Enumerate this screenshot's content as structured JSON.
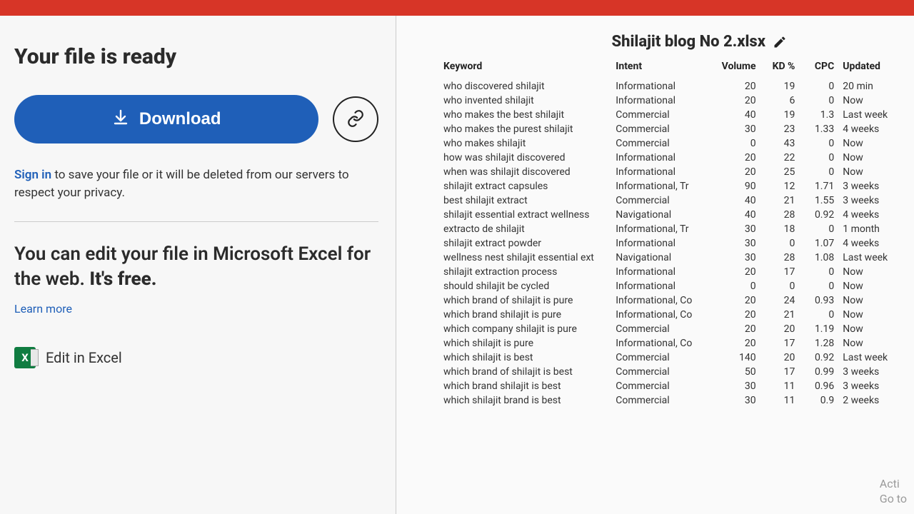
{
  "left": {
    "heading": "Your file is ready",
    "download_label": "Download",
    "signin_link": "Sign in",
    "signin_rest": " to save your file or it will be deleted from our servers to respect your privacy.",
    "edit_promo_a": "You can edit your file in Microsoft Excel for the web. ",
    "edit_promo_b": "It's free.",
    "learn_more": "Learn more",
    "excel_label": "Edit in Excel",
    "excel_icon_text": "X"
  },
  "right": {
    "file_title": "Shilajit blog No 2.xlsx",
    "headers": {
      "keyword": "Keyword",
      "intent": "Intent",
      "volume": "Volume",
      "kd": "KD %",
      "cpc": "CPC",
      "updated": "Updated"
    },
    "rows": [
      {
        "keyword": "who discovered shilajit",
        "intent": "Informational",
        "volume": "20",
        "kd": "19",
        "cpc": "0",
        "updated": "20 min"
      },
      {
        "keyword": "who invented shilajit",
        "intent": "Informational",
        "volume": "20",
        "kd": "6",
        "cpc": "0",
        "updated": "Now"
      },
      {
        "keyword": "who makes the best shilajit",
        "intent": "Commercial",
        "volume": "40",
        "kd": "19",
        "cpc": "1.3",
        "updated": "Last week"
      },
      {
        "keyword": "who makes the purest shilajit",
        "intent": "Commercial",
        "volume": "30",
        "kd": "23",
        "cpc": "1.33",
        "updated": "4 weeks"
      },
      {
        "keyword": "who makes shilajit",
        "intent": "Commercial",
        "volume": "0",
        "kd": "43",
        "cpc": "0",
        "updated": "Now"
      },
      {
        "keyword": "how was shilajit discovered",
        "intent": "Informational",
        "volume": "20",
        "kd": "22",
        "cpc": "0",
        "updated": "Now"
      },
      {
        "keyword": "when was shilajit discovered",
        "intent": "Informational",
        "volume": "20",
        "kd": "25",
        "cpc": "0",
        "updated": "Now"
      },
      {
        "keyword": "shilajit extract capsules",
        "intent": "Informational, Tr",
        "volume": "90",
        "kd": "12",
        "cpc": "1.71",
        "updated": "3 weeks"
      },
      {
        "keyword": "best shilajit extract",
        "intent": "Commercial",
        "volume": "40",
        "kd": "21",
        "cpc": "1.55",
        "updated": "3 weeks"
      },
      {
        "keyword": "shilajit essential extract wellness",
        "intent": "Navigational",
        "volume": "40",
        "kd": "28",
        "cpc": "0.92",
        "updated": "4 weeks"
      },
      {
        "keyword": "extracto de shilajit",
        "intent": "Informational, Tr",
        "volume": "30",
        "kd": "18",
        "cpc": "0",
        "updated": "1 month"
      },
      {
        "keyword": "shilajit extract powder",
        "intent": "Informational",
        "volume": "30",
        "kd": "0",
        "cpc": "1.07",
        "updated": "4 weeks"
      },
      {
        "keyword": "wellness nest shilajit essential ext",
        "intent": "Navigational",
        "volume": "30",
        "kd": "28",
        "cpc": "1.08",
        "updated": "Last week"
      },
      {
        "keyword": "shilajit extraction process",
        "intent": "Informational",
        "volume": "20",
        "kd": "17",
        "cpc": "0",
        "updated": "Now"
      },
      {
        "keyword": "should shilajit be cycled",
        "intent": "Informational",
        "volume": "0",
        "kd": "0",
        "cpc": "0",
        "updated": "Now"
      },
      {
        "keyword": "which brand of shilajit is pure",
        "intent": "Informational, Co",
        "volume": "20",
        "kd": "24",
        "cpc": "0.93",
        "updated": "Now"
      },
      {
        "keyword": "which brand shilajit is pure",
        "intent": "Informational, Co",
        "volume": "20",
        "kd": "21",
        "cpc": "0",
        "updated": "Now"
      },
      {
        "keyword": "which company shilajit is pure",
        "intent": "Commercial",
        "volume": "20",
        "kd": "20",
        "cpc": "1.19",
        "updated": "Now"
      },
      {
        "keyword": "which shilajit is pure",
        "intent": "Informational, Co",
        "volume": "20",
        "kd": "17",
        "cpc": "1.28",
        "updated": "Now"
      },
      {
        "keyword": "which shilajit is best",
        "intent": "Commercial",
        "volume": "140",
        "kd": "20",
        "cpc": "0.92",
        "updated": "Last week"
      },
      {
        "keyword": "which brand of shilajit is best",
        "intent": "Commercial",
        "volume": "50",
        "kd": "17",
        "cpc": "0.99",
        "updated": "3 weeks"
      },
      {
        "keyword": "which brand shilajit is best",
        "intent": "Commercial",
        "volume": "30",
        "kd": "11",
        "cpc": "0.96",
        "updated": "3 weeks"
      },
      {
        "keyword": "which shilajit brand is best",
        "intent": "Commercial",
        "volume": "30",
        "kd": "11",
        "cpc": "0.9",
        "updated": "2 weeks"
      }
    ]
  },
  "watermark": {
    "line1": "Acti",
    "line2": "Go to"
  }
}
